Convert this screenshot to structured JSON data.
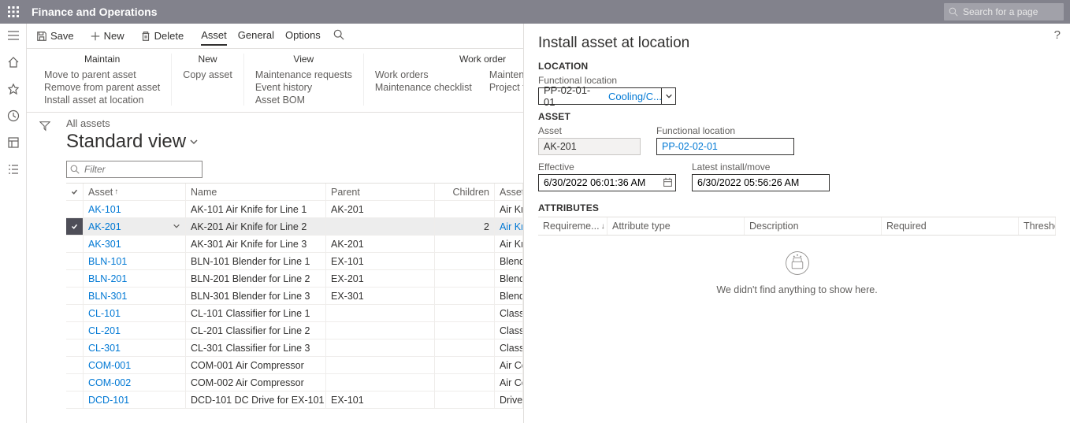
{
  "header": {
    "app_title": "Finance and Operations",
    "search_placeholder": "Search for a page"
  },
  "actionbar": {
    "save": "Save",
    "new": "New",
    "delete": "Delete",
    "tabs": [
      "Asset",
      "General",
      "Options"
    ]
  },
  "ribbon": {
    "maintain": {
      "title": "Maintain",
      "items": [
        "Move to parent asset",
        "Remove from parent asset",
        "Install asset at location"
      ]
    },
    "new": {
      "title": "New",
      "items": [
        "Copy asset"
      ]
    },
    "view": {
      "title": "View",
      "items": [
        "Maintenance requests",
        "Event history",
        "Asset BOM"
      ]
    },
    "workorder": {
      "title": "Work order",
      "items_a": [
        "Work orders",
        "Maintenance checklist"
      ],
      "items_b": [
        "Maintenance downtime",
        "Project transactions"
      ]
    }
  },
  "list": {
    "breadcrumb": "All assets",
    "view_name": "Standard view",
    "filter_placeholder": "Filter",
    "columns": {
      "asset": "Asset",
      "name": "Name",
      "parent": "Parent",
      "children": "Children",
      "type": "Asset t"
    },
    "rows": [
      {
        "asset": "AK-101",
        "name": "AK-101 Air Knife for Line 1",
        "parent": "AK-201",
        "children": "",
        "type": "Air Kn",
        "sel": false
      },
      {
        "asset": "AK-201",
        "name": "AK-201 Air Knife for Line 2",
        "parent": "",
        "children": "2",
        "type": "Air Kn",
        "sel": true
      },
      {
        "asset": "AK-301",
        "name": "AK-301 Air Knife for Line 3",
        "parent": "AK-201",
        "children": "",
        "type": "Air Kn",
        "sel": false
      },
      {
        "asset": "BLN-101",
        "name": "BLN-101 Blender for Line 1",
        "parent": "EX-101",
        "children": "",
        "type": "Blend",
        "sel": false
      },
      {
        "asset": "BLN-201",
        "name": "BLN-201 Blender for Line 2",
        "parent": "EX-201",
        "children": "",
        "type": "Blend",
        "sel": false
      },
      {
        "asset": "BLN-301",
        "name": "BLN-301 Blender for Line 3",
        "parent": "EX-301",
        "children": "",
        "type": "Blend",
        "sel": false
      },
      {
        "asset": "CL-101",
        "name": "CL-101 Classifier for Line 1",
        "parent": "",
        "children": "",
        "type": "Classif",
        "sel": false
      },
      {
        "asset": "CL-201",
        "name": "CL-201 Classifier for Line 2",
        "parent": "",
        "children": "",
        "type": "Classif",
        "sel": false
      },
      {
        "asset": "CL-301",
        "name": "CL-301 Classifier for Line 3",
        "parent": "",
        "children": "",
        "type": "Classif",
        "sel": false
      },
      {
        "asset": "COM-001",
        "name": "COM-001 Air Compressor",
        "parent": "",
        "children": "",
        "type": "Air Co",
        "sel": false
      },
      {
        "asset": "COM-002",
        "name": "COM-002 Air Compressor",
        "parent": "",
        "children": "",
        "type": "Air Co",
        "sel": false
      },
      {
        "asset": "DCD-101",
        "name": "DCD-101 DC Drive for EX-101",
        "parent": "EX-101",
        "children": "",
        "type": "Drive-",
        "sel": false
      }
    ]
  },
  "panel": {
    "title": "Install asset at location",
    "sec_location": "LOCATION",
    "fld_funcloc": "Functional location",
    "funcloc_code": "PP-02-01-01",
    "funcloc_name": "Cooling/C...",
    "sec_asset": "ASSET",
    "fld_asset": "Asset",
    "asset_val": "AK-201",
    "fld_funcloc2": "Functional location",
    "funcloc2_val": "PP-02-02-01",
    "fld_effective": "Effective",
    "effective_val": "6/30/2022 06:01:36 AM",
    "fld_latest": "Latest install/move",
    "latest_val": "6/30/2022 05:56:26 AM",
    "sec_attr": "ATTRIBUTES",
    "attr_cols": {
      "req": "Requireme...",
      "type": "Attribute type",
      "desc": "Description",
      "required": "Required",
      "thresh": "Thresho"
    },
    "empty_msg": "We didn't find anything to show here."
  }
}
